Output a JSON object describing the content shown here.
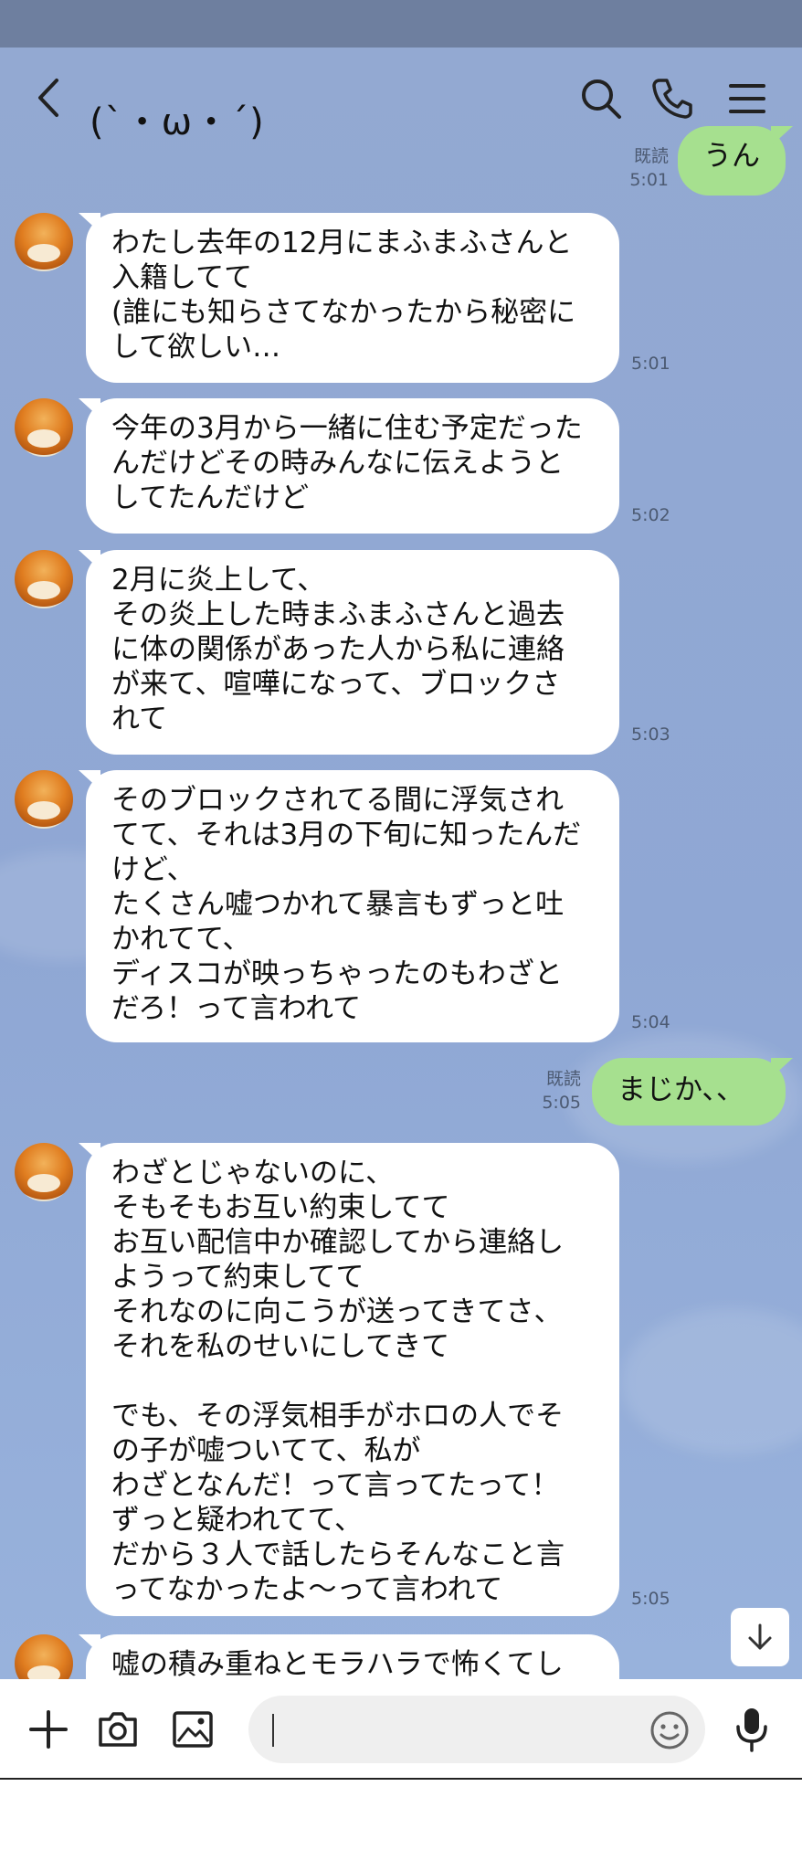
{
  "header": {
    "title": "(`・ω・´)"
  },
  "messages": [
    {
      "side": "out",
      "text": "うん",
      "read": "既読",
      "time": "5:01"
    },
    {
      "side": "in",
      "text": "わたし去年の12月にまふまふさんと\n入籍してて\n(誰にも知らさてなかったから秘密に\nして欲しい…",
      "time": "5:01"
    },
    {
      "side": "in",
      "text": "今年の3月から一緒に住む予定だった\nんだけどその時みんなに伝えようと\nしてたんだけど",
      "time": "5:02"
    },
    {
      "side": "in",
      "text": "2月に炎上して、\nその炎上した時まふまふさんと過去\nに体の関係があった人から私に連絡\nが来て、喧嘩になって、ブロックさ\nれて",
      "time": "5:03"
    },
    {
      "side": "in",
      "text": "そのブロックされてる間に浮気され\nてて、それは3月の下旬に知ったんだ\nけど、\nたくさん嘘つかれて暴言もずっと吐\nかれてて、\nディスコが映っちゃったのもわざと\nだろ！って言われて",
      "time": "5:04"
    },
    {
      "side": "out",
      "text": "まじか、、",
      "read": "既読",
      "time": "5:05"
    },
    {
      "side": "in",
      "text": "わざとじゃないのに、\nそもそもお互い約束してて\nお互い配信中か確認してから連絡し\nようって約束してて\nそれなのに向こうが送ってきてさ、\nそれを私のせいにしてきて\n\nでも、その浮気相手がホロの人でそ\nの子が嘘ついてて、私が\nわざとなんだ！って言ってたって！\nずっと疑われてて、\nだから３人で話したらそんなこと言\nってなかったよ〜って言われて",
      "time": "5:05"
    },
    {
      "side": "in",
      "text": "嘘の積み重ねとモラハラで怖くてし",
      "time": ""
    }
  ],
  "input": {
    "placeholder": ""
  },
  "colors": {
    "header_bg": "#6e7f9f",
    "chat_bg": "#93a9d2",
    "incoming_bubble": "#ffffff",
    "outgoing_bubble": "#a6e08f"
  },
  "icons": {
    "back": "chevron-left-icon",
    "search": "search-icon",
    "call": "phone-icon",
    "menu": "menu-icon",
    "plus": "plus-icon",
    "camera": "camera-icon",
    "image": "image-icon",
    "emoji": "emoji-icon",
    "mic": "microphone-icon",
    "scroll": "arrow-down-icon"
  }
}
